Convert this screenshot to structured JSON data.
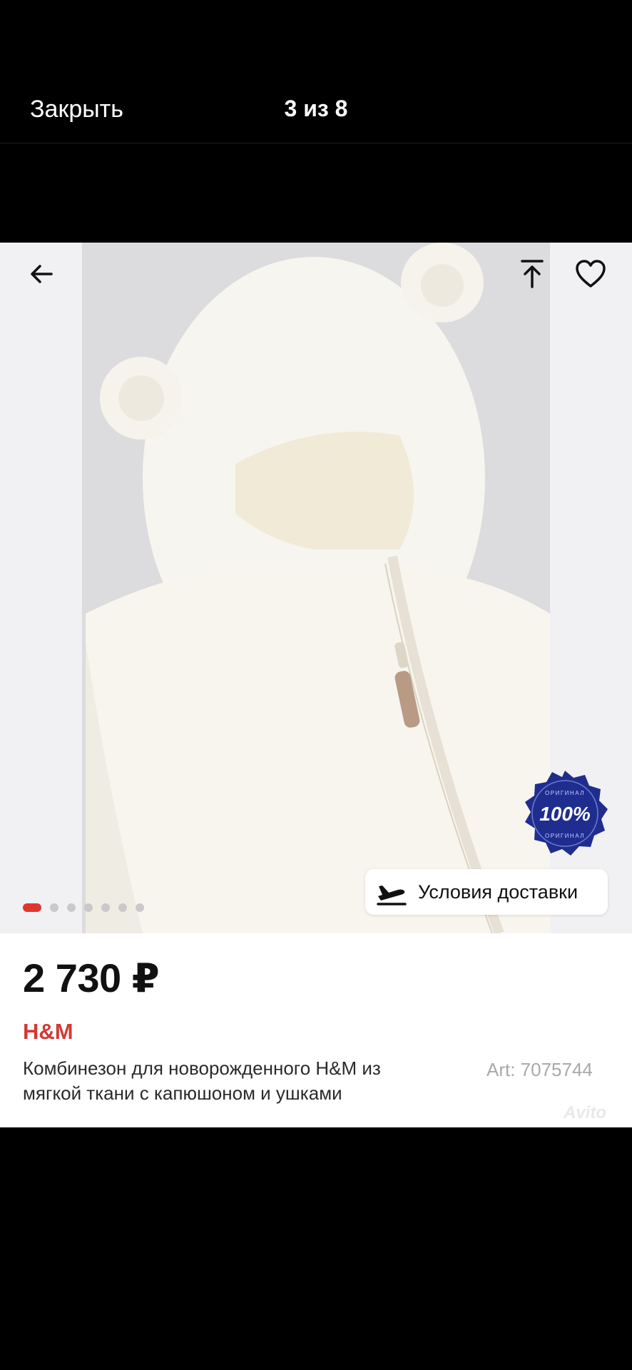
{
  "header": {
    "close_label": "Закрыть",
    "counter": "3 из 8"
  },
  "gallery": {
    "current_index": 1,
    "dot_count": 7,
    "badge_text": "100%",
    "badge_ring_text": "ОРИГИНАЛ",
    "delivery_label": "Условия доставки",
    "icons": [
      "back-arrow-icon",
      "share-upload-icon",
      "heart-icon",
      "plane-takeoff-icon"
    ]
  },
  "product": {
    "price": "2 730 ₽",
    "brand": "H&M",
    "title": "Комбинезон для новорожденного H&M из мягкой ткани с капюшоном и ушками",
    "article": "Art: 7075744"
  },
  "watermark": "Avito",
  "colors": {
    "accent": "#e0362f",
    "brand": "#d23a34",
    "badge": "#1f2d8f"
  }
}
